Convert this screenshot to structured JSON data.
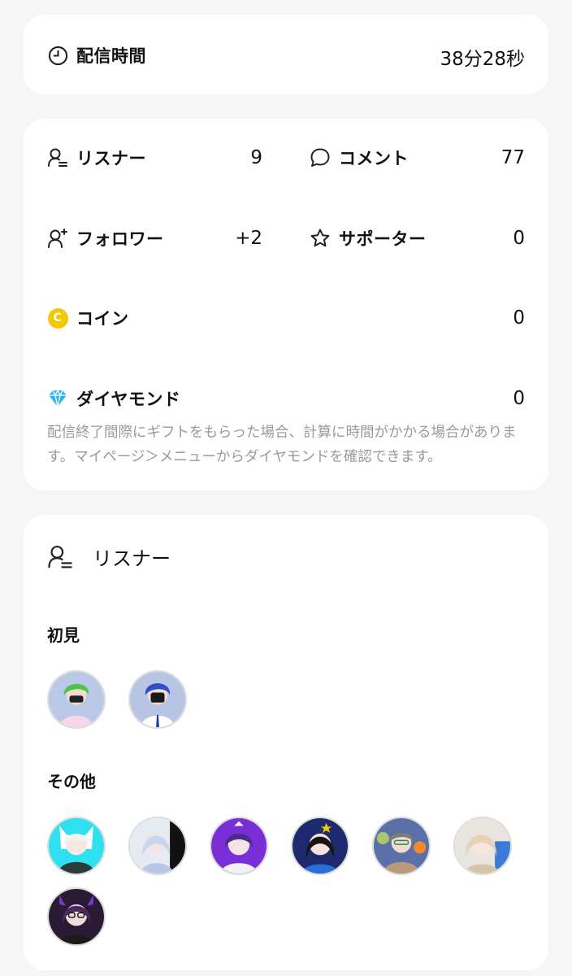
{
  "broadcast_time": {
    "label": "配信時間",
    "value": "38分28秒",
    "icon": "clock-icon"
  },
  "stats": {
    "listeners": {
      "label": "リスナー",
      "value": "9",
      "icon": "listener-icon"
    },
    "comments": {
      "label": "コメント",
      "value": "77",
      "icon": "comment-bubble-icon"
    },
    "followers": {
      "label": "フォロワー",
      "value": "+2",
      "icon": "follower-add-icon"
    },
    "supporters": {
      "label": "サポーター",
      "value": "0",
      "icon": "star-icon"
    },
    "coins": {
      "label": "コイン",
      "value": "0",
      "icon": "coin-icon",
      "icon_letter": "C"
    },
    "diamonds": {
      "label": "ダイヤモンド",
      "value": "0",
      "icon": "diamond-icon"
    },
    "note": "配信終了間際にギフトをもらった場合、計算に時間がかかる場合があります。マイページ＞メニューからダイヤモンドを確認できます。"
  },
  "listener_section": {
    "title": "リスナー",
    "first_time_label": "初見",
    "others_label": "その他",
    "first_time_count": 2,
    "others_count": 7
  },
  "colors": {
    "background": "#f6f6f6",
    "card": "#ffffff",
    "coin": "#f2c800",
    "diamond": "#2fb4f0",
    "note_text": "#9a9a9a"
  }
}
